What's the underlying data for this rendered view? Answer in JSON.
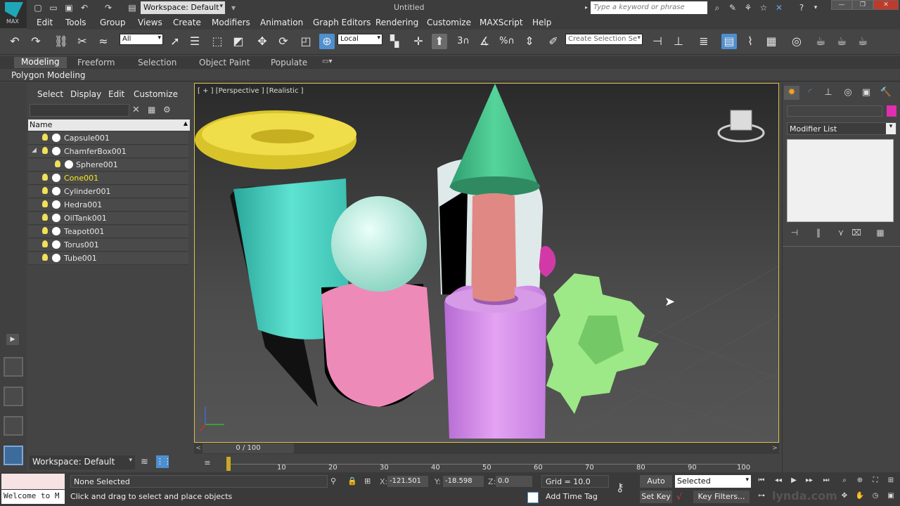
{
  "app": {
    "logo_label": "MAX",
    "title": "Untitled"
  },
  "workspace": {
    "label": "Workspace: Default"
  },
  "search": {
    "placeholder": "Type a keyword or phrase"
  },
  "menu": [
    "Edit",
    "Tools",
    "Group",
    "Views",
    "Create",
    "Modifiers",
    "Animation",
    "Graph Editors",
    "Rendering",
    "Customize",
    "MAXScript",
    "Help"
  ],
  "toolbar": {
    "filter_value": "All",
    "refcoord_value": "Local",
    "selset_placeholder": "Create Selection Se",
    "snaps": [
      "3",
      "%"
    ]
  },
  "ribbon": {
    "tabs": [
      "Modeling",
      "Freeform",
      "Selection",
      "Object Paint",
      "Populate"
    ],
    "panel_label": "Polygon Modeling"
  },
  "explorer": {
    "menu": [
      "Select",
      "Display",
      "Edit",
      "Customize"
    ],
    "column_header": "Name",
    "rows": [
      {
        "name": "Capsule001"
      },
      {
        "name": "ChamferBox001"
      },
      {
        "name": "Sphere001"
      },
      {
        "name": "Cone001"
      },
      {
        "name": "Cylinder001"
      },
      {
        "name": "Hedra001"
      },
      {
        "name": "OilTank001"
      },
      {
        "name": "Teapot001"
      },
      {
        "name": "Torus001"
      },
      {
        "name": "Tube001"
      }
    ],
    "workspace_label": "Workspace: Default"
  },
  "viewport": {
    "label": "[ + ] [Perspective ] [Realistic ]"
  },
  "command_panel": {
    "modifier_list": "Modifier List",
    "object_color": "#e12eb0"
  },
  "timeline": {
    "slider_text": "0 / 100",
    "ticks": [
      "10",
      "20",
      "30",
      "40",
      "50",
      "60",
      "70",
      "80",
      "90",
      "100"
    ]
  },
  "status": {
    "listener_text": "Welcome to M",
    "selection": "None Selected",
    "prompt": "Click and drag to select and place objects",
    "x_label": "X:",
    "x_value": "-121.501",
    "y_label": "Y:",
    "y_value": "-18.598",
    "z_label": "Z:",
    "z_value": "0.0",
    "grid": "Grid = 10.0",
    "add_time_tag": "Add Time Tag",
    "auto_key": "Auto Key",
    "key_mode": "Selected",
    "set_key": "Set Key",
    "key_filters": "Key Filters..."
  },
  "watermark": "lynda.com",
  "colors": {
    "selection_highlight": "#f4e61a",
    "active_blue": "#4e8fd0",
    "viewport_border": "#d8c04c"
  }
}
